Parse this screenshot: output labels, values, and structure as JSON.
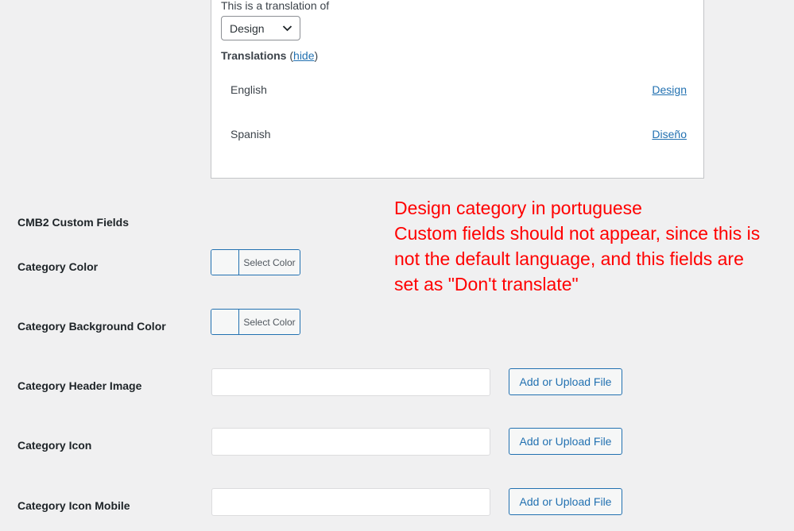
{
  "translation_panel": {
    "translation_of_label": "This is a translation of",
    "select_value": "Design",
    "heading": "Translations",
    "hide_link": "hide",
    "rows": [
      {
        "language": "English",
        "term": "Design"
      },
      {
        "language": "Spanish",
        "term": "Diseño"
      }
    ]
  },
  "annotation": {
    "color": "#ff0000",
    "lines": [
      "Design category in portuguese",
      "Custom fields should not appear, since this is",
      "not the default language, and this fields are",
      "set as \"Don't translate\""
    ]
  },
  "form": {
    "section_title": "CMB2 Custom Fields",
    "fields": [
      {
        "label": "Category Color",
        "button": "Select Color"
      },
      {
        "label": "Category Background Color",
        "button": "Select Color"
      },
      {
        "label": "Category Header Image",
        "button": "Add or Upload File",
        "value": ""
      },
      {
        "label": "Category Icon",
        "button": "Add or Upload File",
        "value": ""
      },
      {
        "label": "Category Icon Mobile",
        "button": "Add or Upload File",
        "value": ""
      }
    ]
  }
}
